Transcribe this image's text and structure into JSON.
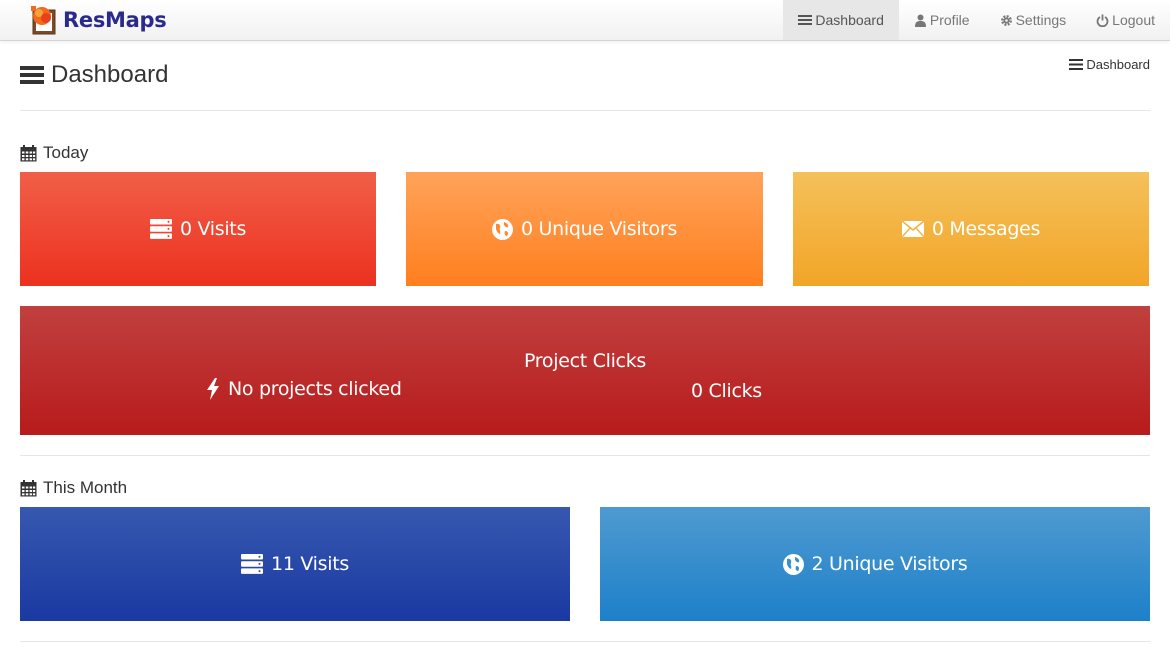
{
  "app": {
    "brand": "ResMaps"
  },
  "nav": {
    "items": [
      {
        "label": "Dashboard",
        "icon": "list-icon",
        "active": true
      },
      {
        "label": "Profile",
        "icon": "user-icon"
      },
      {
        "label": "Settings",
        "icon": "gear-icon"
      },
      {
        "label": "Logout",
        "icon": "power-icon"
      }
    ]
  },
  "header": {
    "title": "Dashboard",
    "breadcrumb": "Dashboard"
  },
  "today": {
    "label": "Today",
    "visits": "0 Visits",
    "unique_visitors": "0 Unique Visitors",
    "messages": "0 Messages",
    "project_clicks": {
      "title": "Project Clicks",
      "project": "No projects clicked",
      "clicks": "0 Clicks"
    }
  },
  "month": {
    "label": "This Month",
    "visits": "11 Visits",
    "unique_visitors": "2 Unique Visitors"
  },
  "colors": {
    "brand": "#2a2a8c",
    "visits_today": "#ec3120",
    "visitors_today": "#ff7f1e",
    "messages_today": "#f2a528",
    "project_clicks": "#b81b1b",
    "visits_month": "#1a39a2",
    "visitors_month": "#1d80c9"
  }
}
